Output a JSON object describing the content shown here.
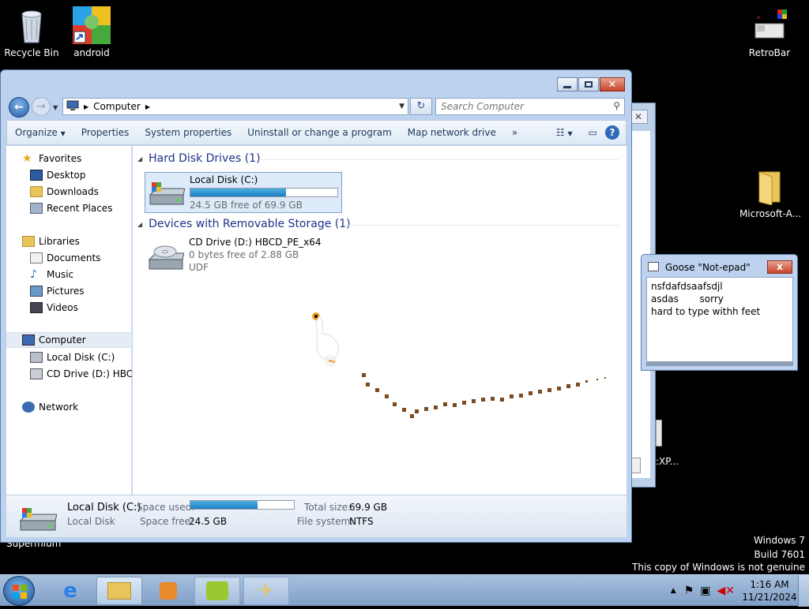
{
  "desktop": {
    "icons": [
      {
        "label": "Recycle Bin",
        "icon": "recycle-bin-icon"
      },
      {
        "label": "android",
        "icon": "android-shortcut-icon"
      },
      {
        "label": "RetroBar",
        "icon": "retrobar-icon"
      },
      {
        "label": "Microsoft-A...",
        "icon": "folder-icon"
      }
    ],
    "supermium_label": "Supermium",
    "background_xp_text": ":XP...",
    "watermark": {
      "line1": "Windows 7",
      "line2": "Build 7601",
      "line3": "This copy of Windows is not genuine"
    }
  },
  "explorer": {
    "address": {
      "root_icon": "computer-icon",
      "segment": "Computer"
    },
    "search_placeholder": "Search Computer",
    "commands": [
      "Organize",
      "Properties",
      "System properties",
      "Uninstall or change a program",
      "Map network drive"
    ],
    "overflow": "»",
    "nav": {
      "favorites": "Favorites",
      "desktop": "Desktop",
      "downloads": "Downloads",
      "recent": "Recent Places",
      "libraries": "Libraries",
      "documents": "Documents",
      "music": "Music",
      "pictures": "Pictures",
      "videos": "Videos",
      "computer": "Computer",
      "local_disk": "Local Disk (C:)",
      "cd_drive": "CD Drive (D:) HBCD_",
      "network": "Network"
    },
    "groups": {
      "hdd": "Hard Disk Drives (1)",
      "removable": "Devices with Removable Storage (1)"
    },
    "drives": [
      {
        "name": "Local Disk (C:)",
        "used_fraction": 0.65,
        "free_text": "24.5 GB free of 69.9 GB"
      },
      {
        "name": "CD Drive (D:) HBCD_PE_x64",
        "free_text": "0 bytes free of 2.88 GB",
        "fs": "UDF"
      }
    ],
    "details": {
      "name": "Local Disk (C:)",
      "type": "Local Disk",
      "space_used_label": "Space used:",
      "space_used_fraction": 0.65,
      "space_free_label": "Space free:",
      "space_free": "24.5 GB",
      "total_size_label": "Total size:",
      "total_size": "69.9 GB",
      "file_system_label": "File system:",
      "file_system": "NTFS"
    }
  },
  "notepad": {
    "title": "Goose \"Not-epad\"",
    "close": "x",
    "lines": [
      "nsfdafdsaafsdjl",
      "asdas       sorry",
      "hard to type withh feet"
    ]
  },
  "taskbar": {
    "clock_time": "1:16 AM",
    "clock_date": "11/21/2024",
    "colors": {
      "accent": "#7f9ec6",
      "progress": "#1d7fc0"
    }
  }
}
